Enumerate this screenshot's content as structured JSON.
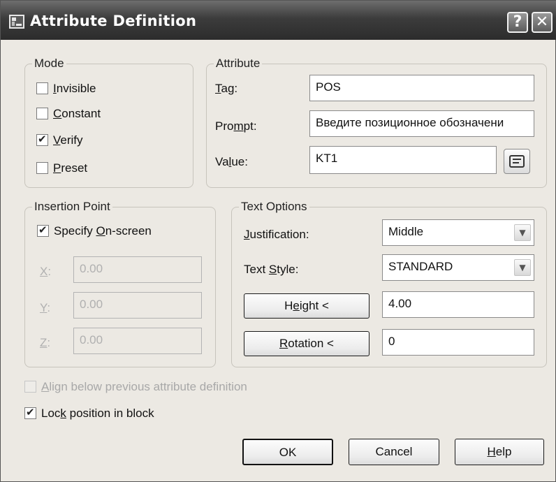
{
  "window": {
    "title": "Attribute Definition",
    "help_button": "?",
    "close_button": "✕"
  },
  "mode": {
    "legend": "Mode",
    "items": [
      {
        "pre": "",
        "key": "I",
        "post": "nvisible",
        "checked": false
      },
      {
        "pre": "",
        "key": "C",
        "post": "onstant",
        "checked": false
      },
      {
        "pre": "",
        "key": "V",
        "post": "erify",
        "checked": true
      },
      {
        "pre": "",
        "key": "P",
        "post": "reset",
        "checked": false
      }
    ]
  },
  "attribute": {
    "legend": "Attribute",
    "tag_label": {
      "pre": "",
      "key": "T",
      "post": "ag:"
    },
    "tag_value": "POS",
    "prompt_label": {
      "pre": "Pro",
      "key": "m",
      "post": "pt:"
    },
    "prompt_value": "Введите позиционное обозначени",
    "value_label": {
      "pre": "Va",
      "key": "l",
      "post": "ue:"
    },
    "value_value": "KT1",
    "field_button_icon": "insert-field-icon"
  },
  "insertion": {
    "legend": "Insertion Point",
    "specify": {
      "pre": "Specify ",
      "key": "O",
      "post": "n-screen",
      "checked": true
    },
    "x_label": {
      "pre": "",
      "key": "X",
      "post": ":"
    },
    "x_value": "0.00",
    "y_label": {
      "pre": "",
      "key": "Y",
      "post": ":"
    },
    "y_value": "0.00",
    "z_label": {
      "pre": "",
      "key": "Z",
      "post": ":"
    },
    "z_value": "0.00"
  },
  "text_options": {
    "legend": "Text Options",
    "justification_label": {
      "pre": "",
      "key": "J",
      "post": "ustification:"
    },
    "justification_value": "Middle",
    "style_label": {
      "pre": "Text ",
      "key": "S",
      "post": "tyle:"
    },
    "style_value": "STANDARD",
    "height_button": {
      "pre": "H",
      "key": "e",
      "post": "ight <"
    },
    "height_value": "4.00",
    "rotation_button": {
      "pre": "",
      "key": "R",
      "post": "otation <"
    },
    "rotation_value": "0"
  },
  "align": {
    "pre": "",
    "key": "A",
    "post": "lign below previous attribute definition",
    "checked": false
  },
  "lock": {
    "pre": "Loc",
    "key": "k",
    "post": " position in block",
    "checked": true
  },
  "buttons": {
    "ok": {
      "pre": "OK",
      "key": "",
      "post": ""
    },
    "cancel": {
      "pre": "Cancel",
      "key": "",
      "post": ""
    },
    "help": {
      "pre": "",
      "key": "H",
      "post": "elp"
    }
  }
}
